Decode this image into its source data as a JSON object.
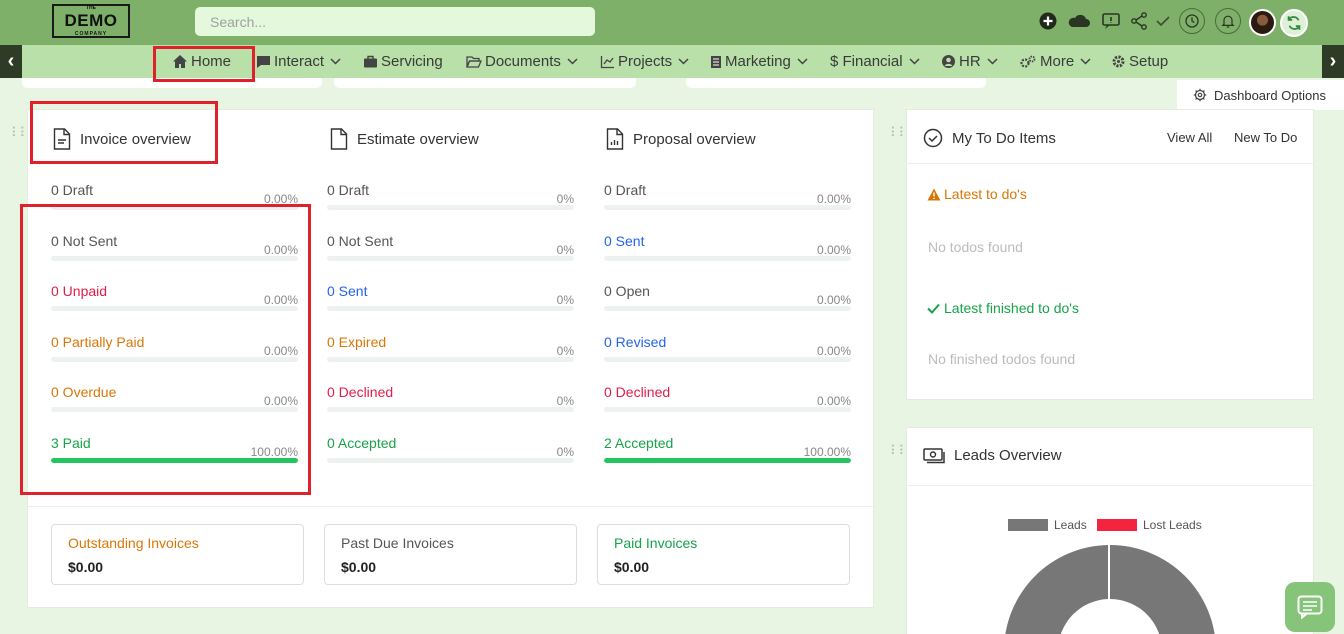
{
  "logo": {
    "the": "THE",
    "name": "DEMO",
    "company": "COMPANY"
  },
  "search": {
    "placeholder": "Search..."
  },
  "nav": {
    "items": [
      {
        "label": "Home"
      },
      {
        "label": "Interact"
      },
      {
        "label": "Servicing"
      },
      {
        "label": "Documents"
      },
      {
        "label": "Projects"
      },
      {
        "label": "Marketing"
      },
      {
        "label": "$ Financial"
      },
      {
        "label": "HR"
      },
      {
        "label": "More"
      },
      {
        "label": "Setup"
      }
    ]
  },
  "dashboard_options": "Dashboard Options",
  "invoice": {
    "title": "Invoice overview",
    "stats": [
      {
        "label": "0 Draft",
        "pct": "0.00%",
        "fill": 0
      },
      {
        "label": "0 Not Sent",
        "pct": "0.00%",
        "fill": 0
      },
      {
        "label": "0 Unpaid",
        "pct": "0.00%",
        "fill": 0
      },
      {
        "label": "0 Partially Paid",
        "pct": "0.00%",
        "fill": 0
      },
      {
        "label": "0 Overdue",
        "pct": "0.00%",
        "fill": 0
      },
      {
        "label": "3 Paid",
        "pct": "100.00%",
        "fill": 100
      }
    ]
  },
  "estimate": {
    "title": "Estimate overview",
    "stats": [
      {
        "label": "0 Draft",
        "pct": "0%",
        "fill": 0
      },
      {
        "label": "0 Not Sent",
        "pct": "0%",
        "fill": 0
      },
      {
        "label": "0 Sent",
        "pct": "0%",
        "fill": 0
      },
      {
        "label": "0 Expired",
        "pct": "0%",
        "fill": 0
      },
      {
        "label": "0 Declined",
        "pct": "0%",
        "fill": 0
      },
      {
        "label": "0 Accepted",
        "pct": "0%",
        "fill": 0
      }
    ]
  },
  "proposal": {
    "title": "Proposal overview",
    "stats": [
      {
        "label": "0 Draft",
        "pct": "0.00%",
        "fill": 0
      },
      {
        "label": "0 Sent",
        "pct": "0.00%",
        "fill": 0
      },
      {
        "label": "0 Open",
        "pct": "0.00%",
        "fill": 0
      },
      {
        "label": "0 Revised",
        "pct": "0.00%",
        "fill": 0
      },
      {
        "label": "0 Declined",
        "pct": "0.00%",
        "fill": 0
      },
      {
        "label": "2 Accepted",
        "pct": "100.00%",
        "fill": 100
      }
    ]
  },
  "summary": {
    "outstanding": {
      "title": "Outstanding Invoices",
      "value": "$0.00"
    },
    "past_due": {
      "title": "Past Due Invoices",
      "value": "$0.00"
    },
    "paid": {
      "title": "Paid Invoices",
      "value": "$0.00"
    }
  },
  "todo": {
    "title": "My To Do Items",
    "view_all": "View All",
    "new_todo": "New To Do",
    "latest": "Latest to do's",
    "latest_empty": "No todos found",
    "finished": "Latest finished to do's",
    "finished_empty": "No finished todos found"
  },
  "leads": {
    "title": "Leads Overview",
    "legend": [
      "Leads",
      "Lost Leads"
    ]
  },
  "colors": {
    "topbar": "#7fb069",
    "navbar": "#b9e0a8",
    "highlight": "#e0202a",
    "progress": "#22c55e"
  }
}
